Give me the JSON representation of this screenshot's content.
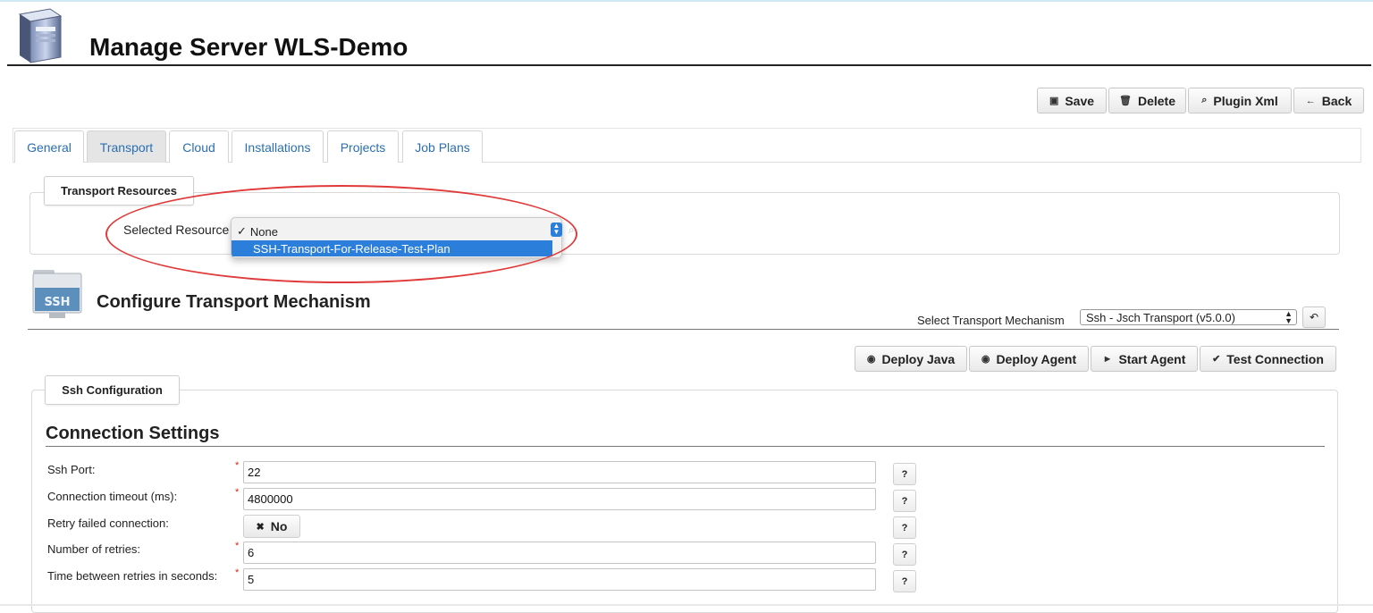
{
  "header": {
    "title": "Manage Server WLS-Demo",
    "icon": "server-icon"
  },
  "toolbar": {
    "save": "Save",
    "delete": "Delete",
    "plugin_xml": "Plugin Xml",
    "back": "Back"
  },
  "tabs": [
    {
      "label": "General"
    },
    {
      "label": "Transport",
      "active": true
    },
    {
      "label": "Cloud"
    },
    {
      "label": "Installations"
    },
    {
      "label": "Projects"
    },
    {
      "label": "Job Plans"
    }
  ],
  "transport_resources": {
    "legend": "Transport Resources",
    "selected_label": "Selected Resource",
    "options": [
      {
        "label": "None",
        "checked": true
      },
      {
        "label": "SSH-Transport-For-Release-Test-Plan",
        "highlighted": true
      }
    ]
  },
  "configure": {
    "title": "Configure Transport Mechanism",
    "icon_text": "SSH",
    "mechanism_label": "Select Transport Mechanism",
    "mechanism_value": "Ssh - Jsch Transport (v5.0.0)",
    "actions": {
      "deploy_java": "Deploy Java",
      "deploy_agent": "Deploy Agent",
      "start_agent": "Start Agent",
      "test_connection": "Test Connection"
    }
  },
  "ssh_config": {
    "legend": "Ssh Configuration",
    "section_title": "Connection Settings",
    "fields": {
      "ssh_port": {
        "label": "Ssh Port:",
        "value": "22"
      },
      "timeout": {
        "label": "Connection timeout (ms):",
        "value": "4800000"
      },
      "retry": {
        "label": "Retry failed connection:",
        "value": "No"
      },
      "num_retries": {
        "label": "Number of retries:",
        "value": "6"
      },
      "time_between": {
        "label": "Time between retries in seconds:",
        "value": "5"
      }
    },
    "required_mark": "*",
    "help_label": "?"
  },
  "colors": {
    "link": "#2a6fb1",
    "highlight": "#2b7fdb",
    "annotation": "#e03a3a",
    "required": "#dd2211"
  }
}
